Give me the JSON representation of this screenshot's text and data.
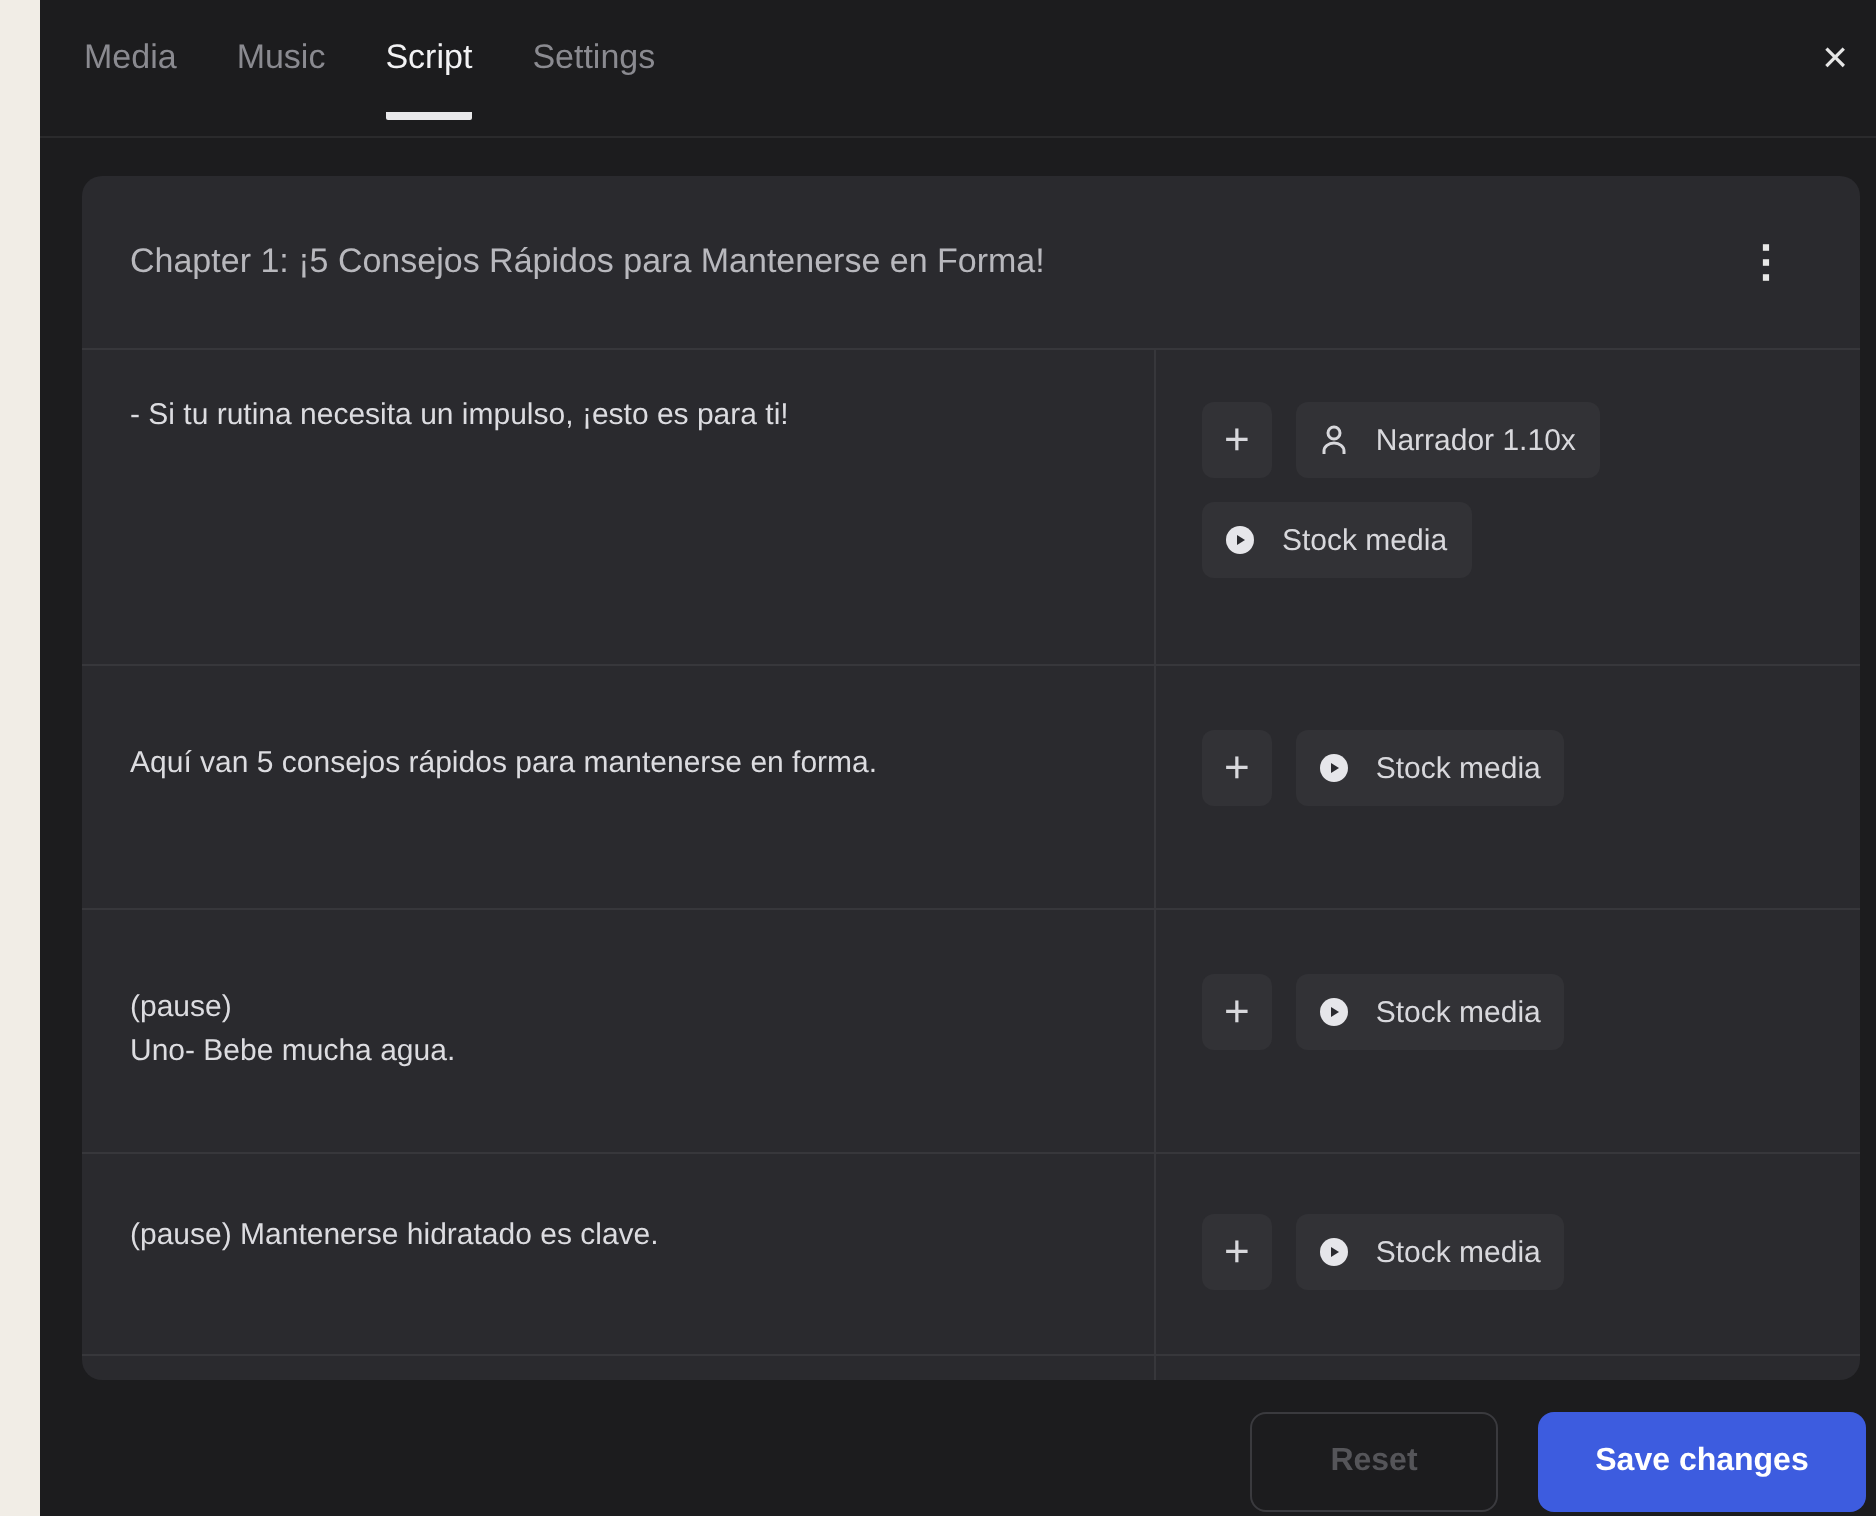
{
  "tabs": [
    {
      "label": "Media",
      "selected": false
    },
    {
      "label": "Music",
      "selected": false
    },
    {
      "label": "Script",
      "selected": true
    },
    {
      "label": "Settings",
      "selected": false
    }
  ],
  "close": "×",
  "chapter": {
    "title": "Chapter 1: ¡5 Consejos Rápidos para Mantenerse en Forma!",
    "menu": "⋮"
  },
  "rows": [
    {
      "text": "- Si tu rutina necesita un impulso, ¡esto es para ti!",
      "add": "+",
      "chips": [
        {
          "kind": "voice",
          "label": "Narrador 1.10x"
        },
        {
          "kind": "media",
          "label": "Stock media"
        }
      ]
    },
    {
      "text": "Aquí van 5 consejos rápidos para mantenerse en forma.",
      "add": "+",
      "chips": [
        {
          "kind": "media",
          "label": "Stock media"
        }
      ]
    },
    {
      "text": "(pause)\nUno- Bebe mucha agua.",
      "add": "+",
      "chips": [
        {
          "kind": "media",
          "label": "Stock media"
        }
      ]
    },
    {
      "text": "(pause) Mantenerse hidratado es clave.",
      "add": "+",
      "chips": [
        {
          "kind": "media",
          "label": "Stock media"
        }
      ]
    }
  ],
  "footer": {
    "reset": {
      "label": "Reset",
      "disabled": true
    },
    "save": {
      "label": "Save changes"
    }
  }
}
